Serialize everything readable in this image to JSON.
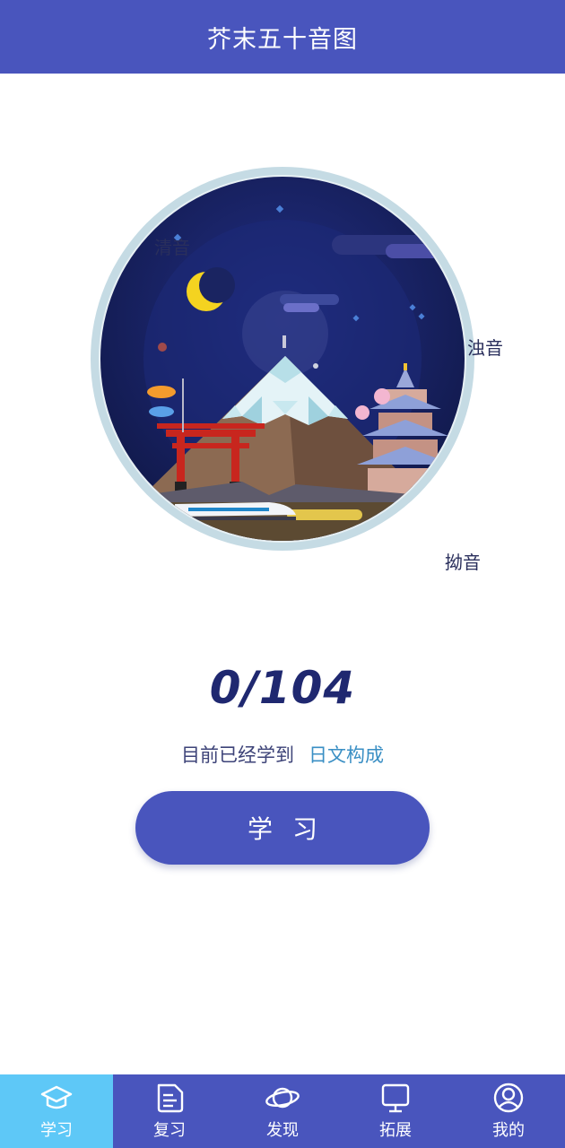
{
  "header": {
    "title": "芥末五十音图"
  },
  "hero": {
    "categories": {
      "qingyin": "清音",
      "zhuoyin": "浊音",
      "aoyin": "拗音"
    }
  },
  "progress": {
    "count": "0/104",
    "prefix": "目前已经学到",
    "topic": "日文构成"
  },
  "study_button": {
    "label": "学习"
  },
  "tabs": [
    {
      "label": "学习",
      "icon": "graduation-cap-icon",
      "active": true
    },
    {
      "label": "复习",
      "icon": "document-icon",
      "active": false
    },
    {
      "label": "发现",
      "icon": "planet-icon",
      "active": false
    },
    {
      "label": "拓展",
      "icon": "monitor-icon",
      "active": false
    },
    {
      "label": "我的",
      "icon": "user-icon",
      "active": false
    }
  ],
  "colors": {
    "primary": "#4955bd",
    "active_tab": "#5ec8f7",
    "progress_text": "#1f2870",
    "topic_link": "#3a8fc4"
  }
}
